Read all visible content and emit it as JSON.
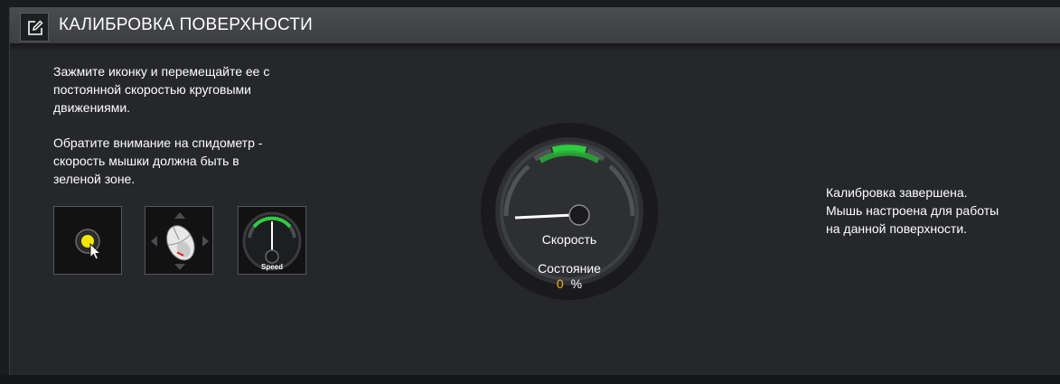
{
  "header": {
    "title": "КАЛИБРОВКА ПОВЕРХНОСТИ",
    "icon": "edit-icon"
  },
  "instructions": {
    "paragraph1": [
      "Зажмите иконку и перемещайте ее с",
      "постоянной скоростью круговыми",
      "движениями."
    ],
    "paragraph2": [
      "Обратите внимание на спидометр -",
      "скорость мышки должна быть в",
      "зеленой зоне."
    ]
  },
  "tiles": [
    {
      "icon": "cursor-target-icon"
    },
    {
      "icon": "mouse-move-icon"
    },
    {
      "icon": "speedometer-icon",
      "label": "Speed"
    }
  ],
  "gauge": {
    "speed_label": "Скорость",
    "status_label": "Состояние",
    "percent_value": "0",
    "percent_unit": "%"
  },
  "result": {
    "lines": [
      "Калибровка завершена.",
      "Мышь настроена для работы",
      "на данной поверхности."
    ]
  },
  "colors": {
    "accent_green": "#2ecc40",
    "percent_yellow": "#f5b800",
    "marker_yellow": "#f2e600"
  }
}
